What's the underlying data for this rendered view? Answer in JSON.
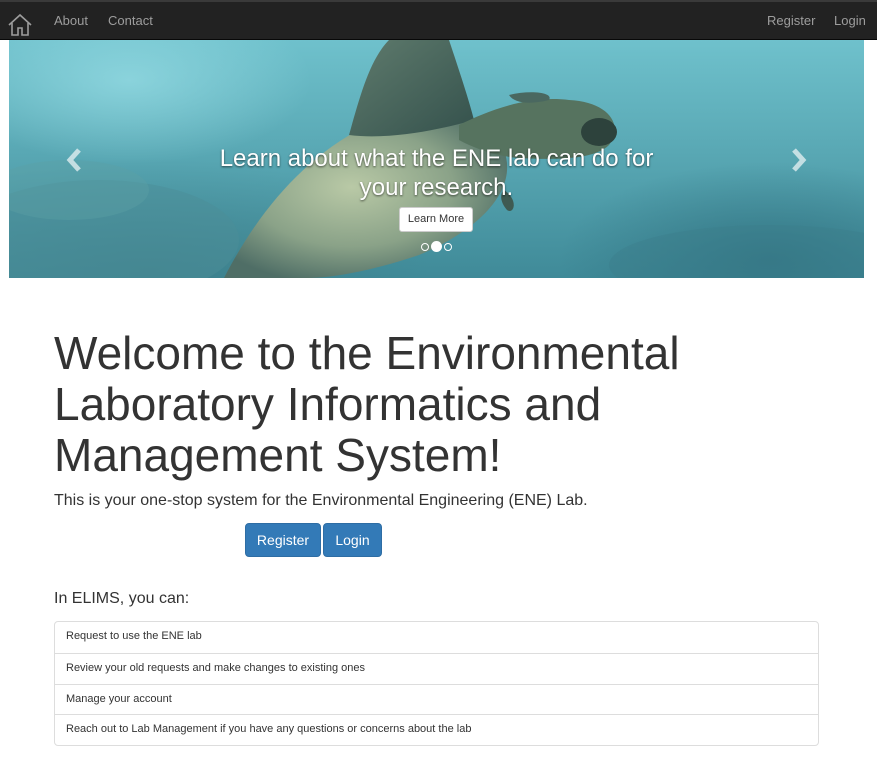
{
  "navbar": {
    "home_icon": "home-icon",
    "left_links": [
      {
        "label": "About"
      },
      {
        "label": "Contact"
      }
    ],
    "right_links": [
      {
        "label": "Register"
      },
      {
        "label": "Login"
      }
    ]
  },
  "carousel": {
    "image": "sea-turtle-underwater-photo",
    "caption_line1": "Learn about what the ENE lab can do for",
    "caption_line2": "your research.",
    "button_label": "Learn More",
    "slide_count": 3,
    "active_slide": 2,
    "prev_icon": "chevron-left-icon",
    "next_icon": "chevron-right-icon"
  },
  "main": {
    "title_lines": [
      "Welcome to the Environmental",
      "Laboratory Informatics and",
      "Management System!"
    ],
    "lead": "This is your one-stop system for the Environmental Engineering (ENE) Lab.",
    "buttons": {
      "register": "Register",
      "login": "Login"
    },
    "features_label": "In ELIMS, you can:",
    "features": [
      "Request to use the ENE lab",
      "Review your old requests and make changes to existing ones",
      "Manage your account",
      "Reach out to Lab Management if you have any questions or concerns about the lab"
    ]
  },
  "colors": {
    "navbar_bg": "#222222",
    "navbar_link": "#9d9d9d",
    "primary": "#337ab7",
    "text": "#333333",
    "border": "#dddddd"
  }
}
